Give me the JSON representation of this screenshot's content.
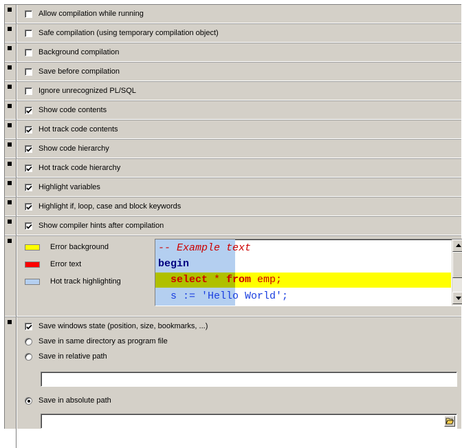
{
  "options": [
    {
      "label": "Allow compilation while running",
      "checked": false
    },
    {
      "label": "Safe compilation (using temporary compilation object)",
      "checked": false
    },
    {
      "label": "Background compilation",
      "checked": false
    },
    {
      "label": "Save before compilation",
      "checked": false
    },
    {
      "label": "Ignore unrecognized PL/SQL",
      "checked": false
    },
    {
      "label": "Show code contents",
      "checked": true
    },
    {
      "label": "Hot track code contents",
      "checked": true
    },
    {
      "label": "Show code hierarchy",
      "checked": true
    },
    {
      "label": "Hot track code hierarchy",
      "checked": true
    },
    {
      "label": "Highlight variables",
      "checked": true
    },
    {
      "label": "Highlight if, loop, case and block keywords",
      "checked": true
    },
    {
      "label": "Show compiler hints after compilation",
      "checked": true
    }
  ],
  "colors": {
    "error_background": {
      "label": "Error background",
      "color": "#ffff00"
    },
    "error_text": {
      "label": "Error text",
      "color": "#ff0000"
    },
    "hot_track": {
      "label": "Hot track highlighting",
      "color": "#b4cff0"
    }
  },
  "example_code": {
    "line1": "-- Example text",
    "line2": "begin",
    "line3_kw1": "select",
    "line3_star": " * ",
    "line3_kw2": "from",
    "line3_rest": " emp;",
    "line4_a": "s := ",
    "line4_b": "'Hello World';"
  },
  "save": {
    "windows_state": {
      "label": "Save windows state (position, size, bookmarks, ...)",
      "checked": true
    },
    "same_dir": {
      "label": "Save in same directory as program file",
      "selected": false
    },
    "relative": {
      "label": "Save in relative path",
      "selected": false,
      "value": ""
    },
    "absolute": {
      "label": "Save in absolute path",
      "selected": true,
      "value": ""
    }
  },
  "icons": {
    "browse": "folder-open-icon",
    "scroll_up": "arrow-up-icon",
    "scroll_down": "arrow-down-icon"
  }
}
